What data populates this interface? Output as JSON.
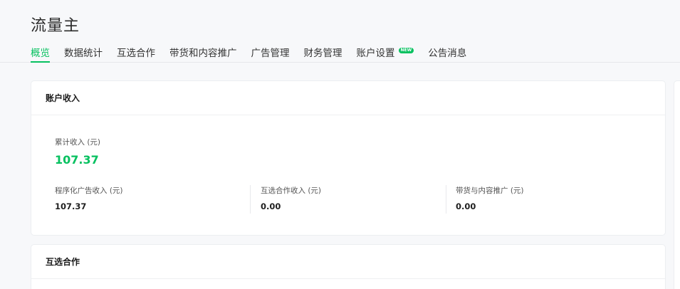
{
  "header": {
    "app_title": "流量主"
  },
  "tabs": [
    {
      "label": "概览",
      "active": true
    },
    {
      "label": "数据统计"
    },
    {
      "label": "互选合作"
    },
    {
      "label": "带货和内容推广"
    },
    {
      "label": "广告管理"
    },
    {
      "label": "财务管理"
    },
    {
      "label": "账户设置",
      "badge": "NEW"
    },
    {
      "label": "公告消息"
    }
  ],
  "account_income": {
    "title": "账户收入",
    "total": {
      "label": "累计收入 (元)",
      "value": "107.37"
    },
    "items": [
      {
        "label": "程序化广告收入 (元)",
        "value": "107.37"
      },
      {
        "label": "互选合作收入 (元)",
        "value": "0.00"
      },
      {
        "label": "带货与内容推广 (元)",
        "value": "0.00"
      }
    ]
  },
  "mutual_selection": {
    "title": "互选合作"
  },
  "colors": {
    "accent": "#07c160",
    "background": "#f7f8fa",
    "card": "#ffffff"
  }
}
